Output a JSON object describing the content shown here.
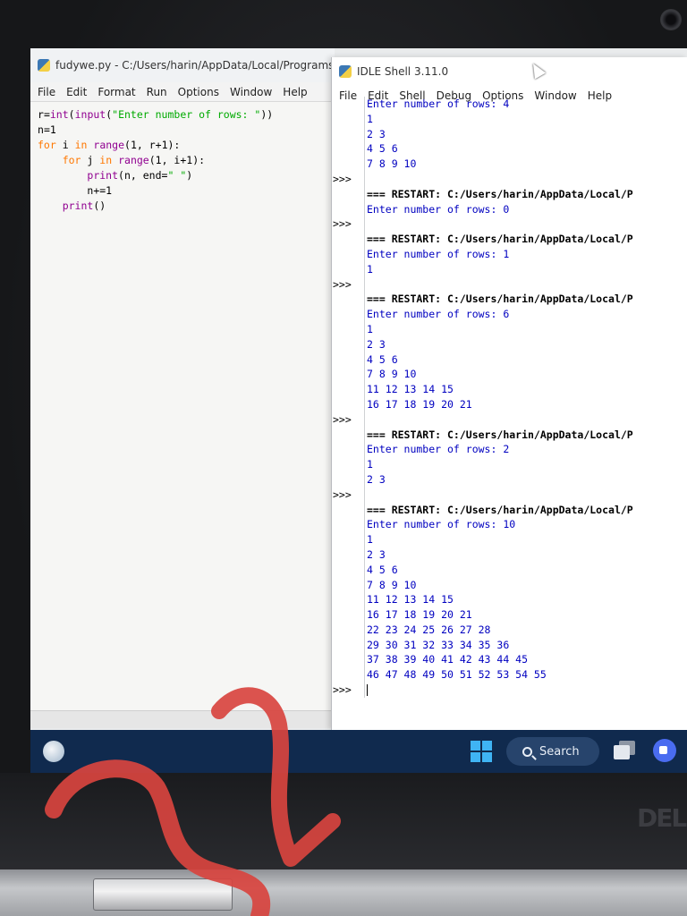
{
  "editor": {
    "title": "fudywe.py - C:/Users/harin/AppData/Local/Programs/P",
    "menu": [
      "File",
      "Edit",
      "Format",
      "Run",
      "Options",
      "Window",
      "Help"
    ],
    "code": [
      "r=int(input(\"Enter number of rows: \"))",
      "n=1",
      "for i in range(1, r+1):",
      "    for j in range(1, i+1):",
      "        print(n, end=\" \")",
      "        n+=1",
      "    print()"
    ]
  },
  "shell": {
    "title": "IDLE Shell 3.11.0",
    "menu": [
      "File",
      "Edit",
      "Shell",
      "Debug",
      "Options",
      "Window",
      "Help"
    ],
    "prompt": ">>>",
    "lines": [
      {
        "text": "Enter number of rows: 4",
        "kind": "out",
        "prompt": ""
      },
      {
        "text": "1",
        "kind": "out",
        "prompt": ""
      },
      {
        "text": "2 3",
        "kind": "out",
        "prompt": ""
      },
      {
        "text": "4 5 6",
        "kind": "out",
        "prompt": ""
      },
      {
        "text": "7 8 9 10",
        "kind": "out",
        "prompt": ""
      },
      {
        "text": "",
        "kind": "out",
        "prompt": ">>>"
      },
      {
        "text": "=== RESTART: C:/Users/harin/AppData/Local/P",
        "kind": "restart",
        "prompt": ""
      },
      {
        "text": "Enter number of rows: 0",
        "kind": "out",
        "prompt": ""
      },
      {
        "text": "",
        "kind": "out",
        "prompt": ">>>"
      },
      {
        "text": "=== RESTART: C:/Users/harin/AppData/Local/P",
        "kind": "restart",
        "prompt": ""
      },
      {
        "text": "Enter number of rows: 1",
        "kind": "out",
        "prompt": ""
      },
      {
        "text": "1",
        "kind": "out",
        "prompt": ""
      },
      {
        "text": "",
        "kind": "out",
        "prompt": ">>>"
      },
      {
        "text": "=== RESTART: C:/Users/harin/AppData/Local/P",
        "kind": "restart",
        "prompt": ""
      },
      {
        "text": "Enter number of rows: 6",
        "kind": "out",
        "prompt": ""
      },
      {
        "text": "1",
        "kind": "out",
        "prompt": ""
      },
      {
        "text": "2 3",
        "kind": "out",
        "prompt": ""
      },
      {
        "text": "4 5 6",
        "kind": "out",
        "prompt": ""
      },
      {
        "text": "7 8 9 10",
        "kind": "out",
        "prompt": ""
      },
      {
        "text": "11 12 13 14 15",
        "kind": "out",
        "prompt": ""
      },
      {
        "text": "16 17 18 19 20 21",
        "kind": "out",
        "prompt": ""
      },
      {
        "text": "",
        "kind": "out",
        "prompt": ">>>"
      },
      {
        "text": "=== RESTART: C:/Users/harin/AppData/Local/P",
        "kind": "restart",
        "prompt": ""
      },
      {
        "text": "Enter number of rows: 2",
        "kind": "out",
        "prompt": ""
      },
      {
        "text": "1",
        "kind": "out",
        "prompt": ""
      },
      {
        "text": "2 3",
        "kind": "out",
        "prompt": ""
      },
      {
        "text": "",
        "kind": "out",
        "prompt": ">>>"
      },
      {
        "text": "=== RESTART: C:/Users/harin/AppData/Local/P",
        "kind": "restart",
        "prompt": ""
      },
      {
        "text": "Enter number of rows: 10",
        "kind": "out",
        "prompt": ""
      },
      {
        "text": "1",
        "kind": "out",
        "prompt": ""
      },
      {
        "text": "2 3",
        "kind": "out",
        "prompt": ""
      },
      {
        "text": "4 5 6",
        "kind": "out",
        "prompt": ""
      },
      {
        "text": "7 8 9 10",
        "kind": "out",
        "prompt": ""
      },
      {
        "text": "11 12 13 14 15",
        "kind": "out",
        "prompt": ""
      },
      {
        "text": "16 17 18 19 20 21",
        "kind": "out",
        "prompt": ""
      },
      {
        "text": "22 23 24 25 26 27 28",
        "kind": "out",
        "prompt": ""
      },
      {
        "text": "29 30 31 32 33 34 35 36",
        "kind": "out",
        "prompt": ""
      },
      {
        "text": "37 38 39 40 41 42 43 44 45",
        "kind": "out",
        "prompt": ""
      },
      {
        "text": "46 47 48 49 50 51 52 53 54 55",
        "kind": "out",
        "prompt": ""
      },
      {
        "text": "",
        "kind": "input",
        "prompt": ">>>"
      }
    ]
  },
  "taskbar": {
    "search_label": "Search"
  },
  "device": {
    "brand": "DELL"
  },
  "colors": {
    "shell_output": "#0000c0",
    "keyword": "#ff7700",
    "builtin": "#900090",
    "string": "#00aa00",
    "taskbar": "#102a4e",
    "scribble": "#d8443f"
  }
}
